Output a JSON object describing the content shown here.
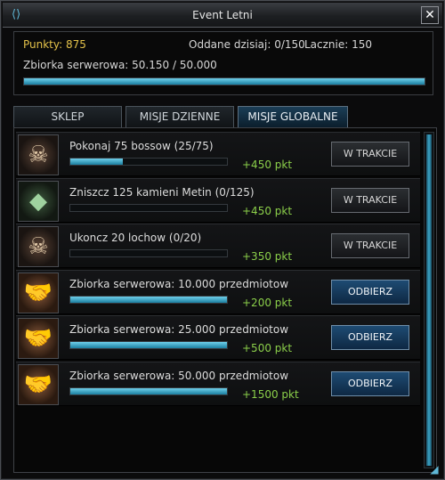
{
  "window": {
    "title": "Event Letni",
    "close_label": "✕"
  },
  "info": {
    "points_label": "Punkty: 875",
    "daily_label": "Oddane dzisiaj: 0/150",
    "total_label": "Lacznie: 150",
    "server_label": "Zbiorka serwerowa: 50.150 / 50.000",
    "server_progress": 1.0
  },
  "tabs": [
    {
      "label": "SKLEP",
      "active": false
    },
    {
      "label": "MISJE DZIENNE",
      "active": false
    },
    {
      "label": "MISJE GLOBALNE",
      "active": true
    }
  ],
  "missions": [
    {
      "title": "Pokonaj 75 bossow (25/75)",
      "progress": 0.333,
      "reward": "+450 pkt",
      "button": "W TRAKCIE",
      "state": "in-progress",
      "icon": "skull-icon"
    },
    {
      "title": "Zniszcz 125 kamieni Metin (0/125)",
      "progress": 0.0,
      "reward": "+450 pkt",
      "button": "W TRAKCIE",
      "state": "in-progress",
      "icon": "metin-stone-icon"
    },
    {
      "title": "Ukoncz 20 lochow (0/20)",
      "progress": 0.0,
      "reward": "+350 pkt",
      "button": "W TRAKCIE",
      "state": "in-progress",
      "icon": "skull-icon"
    },
    {
      "title": "Zbiorka serwerowa: 10.000 przedmiotow",
      "progress": 1.0,
      "reward": "+200 pkt",
      "button": "ODBIERZ",
      "state": "claim",
      "icon": "handshake-icon"
    },
    {
      "title": "Zbiorka serwerowa: 25.000 przedmiotow",
      "progress": 1.0,
      "reward": "+500 pkt",
      "button": "ODBIERZ",
      "state": "claim",
      "icon": "handshake-icon"
    },
    {
      "title": "Zbiorka serwerowa: 50.000 przedmiotow",
      "progress": 1.0,
      "reward": "+1500 pkt",
      "button": "ODBIERZ",
      "state": "claim",
      "icon": "handshake-icon"
    }
  ],
  "colors": {
    "accent": "#3aa5c7",
    "points": "#e4c24a",
    "reward": "#8bcf4a"
  }
}
